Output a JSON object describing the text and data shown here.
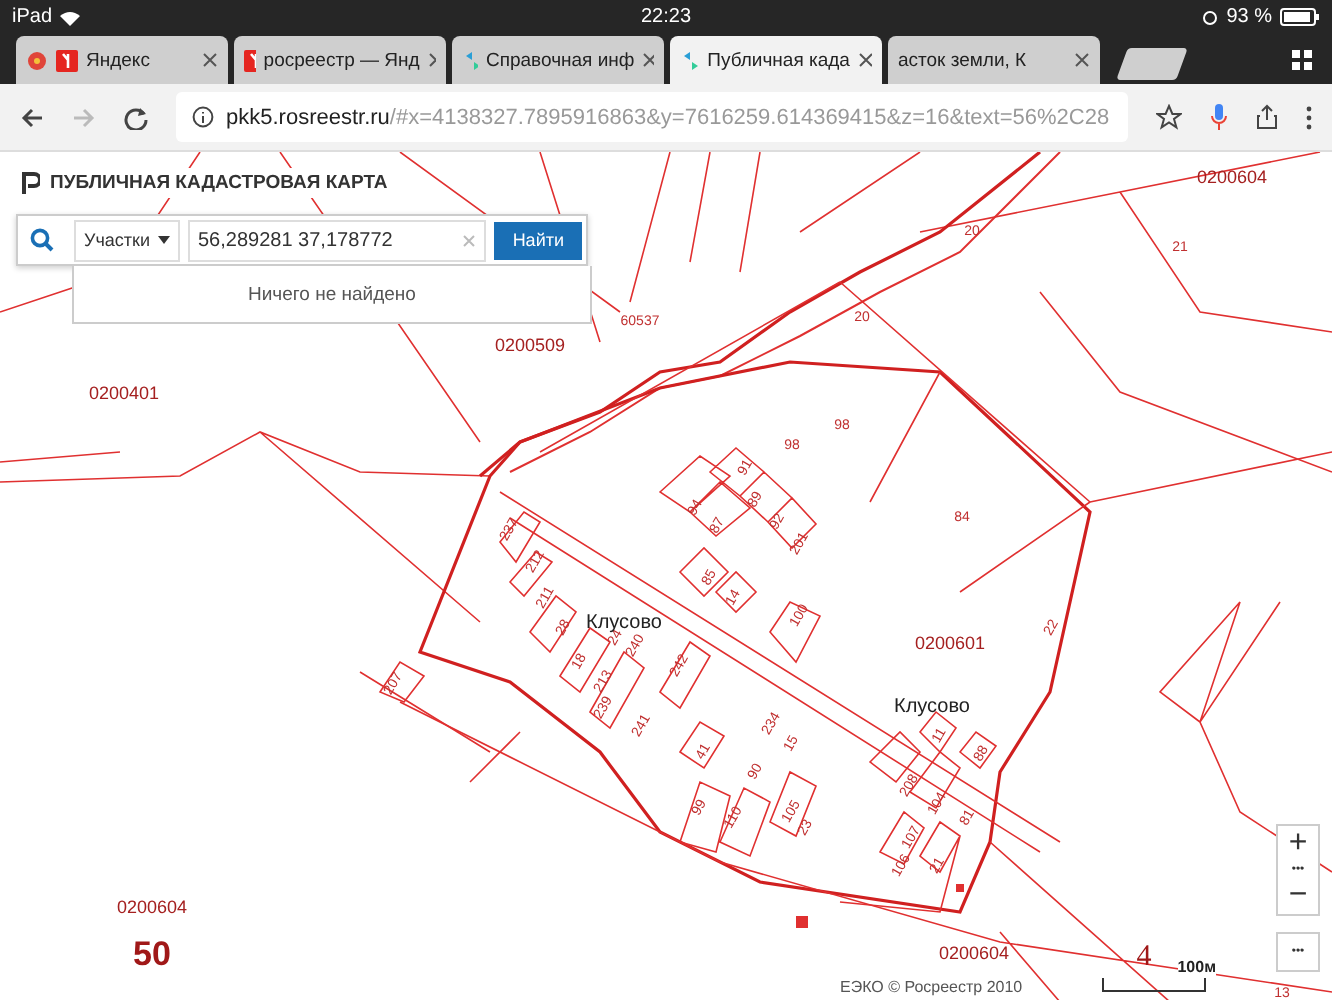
{
  "status_bar": {
    "device": "iPad",
    "time": "22:23",
    "battery": "93 %"
  },
  "tabs": [
    {
      "label": "Яндекс",
      "kind": "yandex",
      "selected": false
    },
    {
      "label": "росреестр — Янд",
      "kind": "yandex",
      "selected": false
    },
    {
      "label": "Справочная инф",
      "kind": "rosreestr",
      "selected": false
    },
    {
      "label": "Публичная када",
      "kind": "rosreestr",
      "selected": true
    },
    {
      "label": "асток земли, К",
      "kind": "none",
      "selected": false
    }
  ],
  "address_bar": {
    "host": "pkk5.rosreestr.ru",
    "path": "/#x=4138327.7895916863&y=7616259.614369415&z=16&text=56%2C28"
  },
  "map_panel": {
    "title": "ПУБЛИЧНАЯ КАДАСТРОВАЯ КАРТА",
    "category": "Участки",
    "value": "56,289281 37,178772",
    "button": "Найти",
    "message": "Ничего не найдено"
  },
  "map_labels": [
    {
      "text": "0200604",
      "kind": "quarter"
    },
    {
      "text": "20",
      "kind": "plot"
    },
    {
      "text": "21",
      "kind": "plot"
    },
    {
      "text": "20",
      "kind": "plot"
    },
    {
      "text": "60537",
      "kind": "plot"
    },
    {
      "text": "0200509",
      "kind": "quarter"
    },
    {
      "text": "0200401",
      "kind": "quarter"
    },
    {
      "text": "98",
      "kind": "plot"
    },
    {
      "text": "98",
      "kind": "plot"
    },
    {
      "text": "84",
      "kind": "plot"
    },
    {
      "text": "91",
      "kind": "plot"
    },
    {
      "text": "94",
      "kind": "plot"
    },
    {
      "text": "87",
      "kind": "plot"
    },
    {
      "text": "89",
      "kind": "plot"
    },
    {
      "text": "92",
      "kind": "plot"
    },
    {
      "text": "201",
      "kind": "plot"
    },
    {
      "text": "85",
      "kind": "plot"
    },
    {
      "text": "14",
      "kind": "plot"
    },
    {
      "text": "100",
      "kind": "plot"
    },
    {
      "text": "237",
      "kind": "plot"
    },
    {
      "text": "212",
      "kind": "plot"
    },
    {
      "text": "211",
      "kind": "plot"
    },
    {
      "text": "28",
      "kind": "plot"
    },
    {
      "text": "18",
      "kind": "plot"
    },
    {
      "text": "213",
      "kind": "plot"
    },
    {
      "text": "24",
      "kind": "plot"
    },
    {
      "text": "240",
      "kind": "plot"
    },
    {
      "text": "239",
      "kind": "plot"
    },
    {
      "text": "241",
      "kind": "plot"
    },
    {
      "text": "242",
      "kind": "plot"
    },
    {
      "text": "Клусово",
      "kind": "place"
    },
    {
      "text": "0200601",
      "kind": "quarter"
    },
    {
      "text": "22",
      "kind": "plot"
    },
    {
      "text": "207",
      "kind": "plot"
    },
    {
      "text": "Клусово",
      "kind": "place"
    },
    {
      "text": "11",
      "kind": "plot"
    },
    {
      "text": "88",
      "kind": "plot"
    },
    {
      "text": "234",
      "kind": "plot"
    },
    {
      "text": "15",
      "kind": "plot"
    },
    {
      "text": "41",
      "kind": "plot"
    },
    {
      "text": "90",
      "kind": "plot"
    },
    {
      "text": "99",
      "kind": "plot"
    },
    {
      "text": "110",
      "kind": "plot"
    },
    {
      "text": "105",
      "kind": "plot"
    },
    {
      "text": "23",
      "kind": "plot"
    },
    {
      "text": "208",
      "kind": "plot"
    },
    {
      "text": "104",
      "kind": "plot"
    },
    {
      "text": "81",
      "kind": "plot"
    },
    {
      "text": "107",
      "kind": "plot"
    },
    {
      "text": "106",
      "kind": "plot"
    },
    {
      "text": "21",
      "kind": "plot"
    },
    {
      "text": "0200604",
      "kind": "quarter"
    },
    {
      "text": "50",
      "kind": "big"
    },
    {
      "text": "0200604",
      "kind": "quarter"
    },
    {
      "text": "4",
      "kind": "serif"
    },
    {
      "text": "13",
      "kind": "plot"
    }
  ],
  "map_controls": {
    "zoom_in": "+",
    "zoom_more": "•••",
    "zoom_out": "−",
    "layers": "•••"
  },
  "attribution": "ЕЭКО © Росреестр 2010",
  "scale": "100м"
}
